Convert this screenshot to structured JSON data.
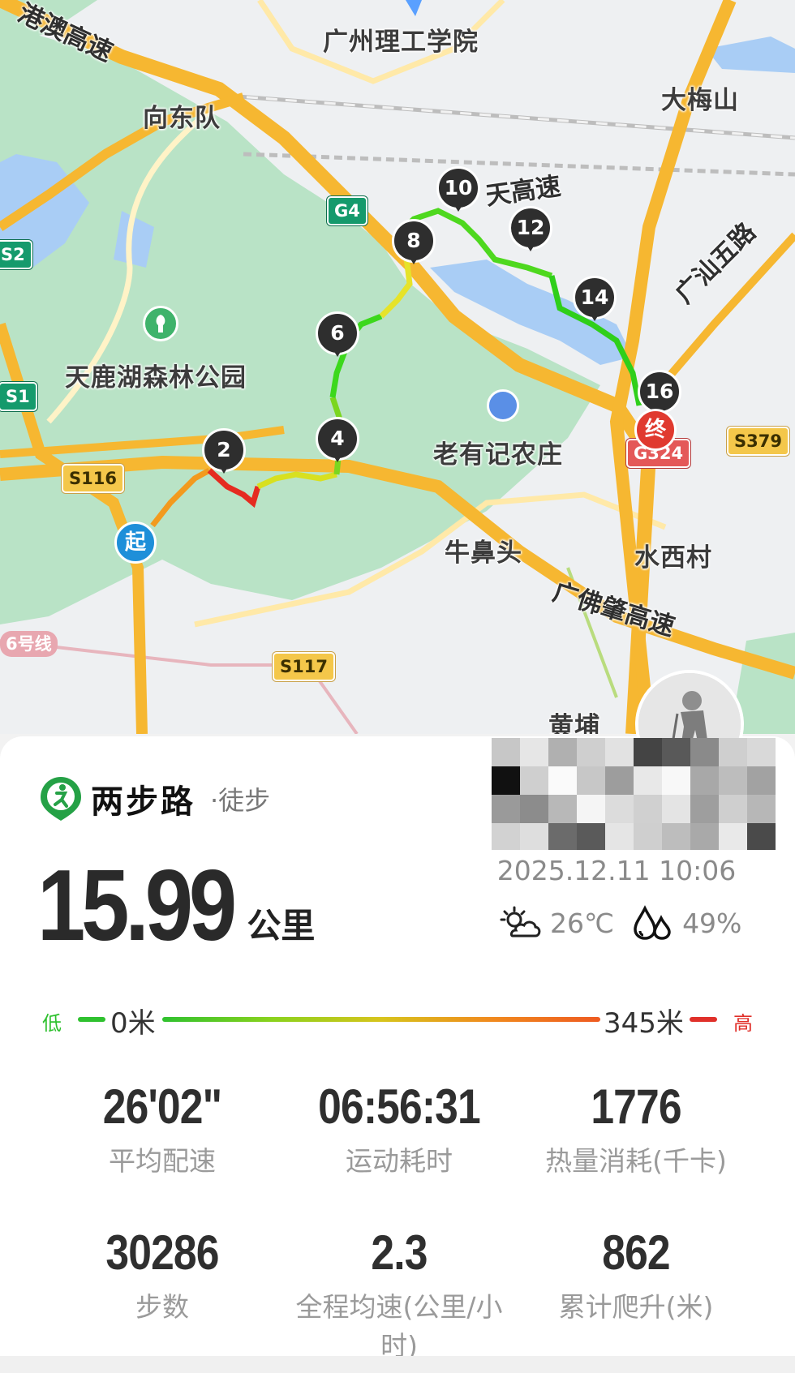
{
  "map": {
    "labels": {
      "university": "广州理工学院",
      "village_east": "向东队",
      "mountain": "大梅山",
      "forest_park": "天鹿湖森林公园",
      "farm": "老有记农庄",
      "niubitou": "牛鼻头",
      "shuixicun": "水西村",
      "huangpu": "黄埔",
      "line6": "6号线"
    },
    "roads": {
      "gangao": "港澳高速",
      "tiangao": "天高速",
      "guangshan": "广汕五路",
      "guangfozhao": "广佛肇高速"
    },
    "shields": {
      "g4": "G4",
      "s2": "S2",
      "s1": "S1",
      "s116": "S116",
      "s117": "S117",
      "s379": "S379",
      "g324": "G324"
    },
    "markers": [
      "2",
      "4",
      "6",
      "8",
      "10",
      "12",
      "14",
      "16"
    ],
    "start_label": "起",
    "end_label": "终",
    "icons": [
      "park-icon",
      "location-pin-icon",
      "avatar-hiker"
    ]
  },
  "panel": {
    "brand_name": "两步路",
    "activity_type": "·徒步",
    "distance_value": "15.99",
    "distance_unit": "公里",
    "datetime": "2025.12.11 10:06",
    "temperature": "26℃",
    "humidity": "49%",
    "elevation": {
      "low_label": "低",
      "high_label": "高",
      "min": "0米",
      "max": "345米",
      "colors": {
        "low": "#2fc12f",
        "high": "#e0302a"
      }
    },
    "stats": [
      {
        "value": "26'02\"",
        "label": "平均配速"
      },
      {
        "value": "06:56:31",
        "label": "运动耗时"
      },
      {
        "value": "1776",
        "label": "热量消耗(千卡)"
      },
      {
        "value": "30286",
        "label": "步数"
      },
      {
        "value": "2.3",
        "label": "全程均速(公里/小时)"
      },
      {
        "value": "862",
        "label": "累计爬升(米)"
      }
    ]
  }
}
